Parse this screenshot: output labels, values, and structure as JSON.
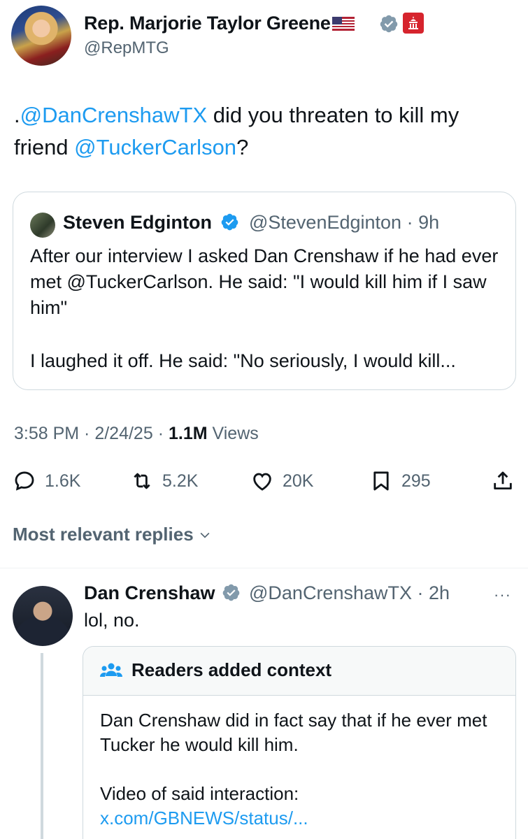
{
  "main_tweet": {
    "author_name": "Rep. Marjorie Taylor Greene",
    "author_handle": "@RepMTG",
    "text_prefix": ".",
    "mention_1": "@DanCrenshawTX",
    "text_middle": " did you threaten to kill my friend ",
    "mention_2": "@TuckerCarlson",
    "text_suffix": "?",
    "time": "3:58 PM",
    "sep_1": " · ",
    "date": "2/24/25",
    "sep_2": " · ",
    "views_count": "1.1M",
    "views_label": " Views"
  },
  "quoted_tweet": {
    "author_name": "Steven Edginton",
    "author_handle": "@StevenEdginton",
    "sep": " · ",
    "age": "9h",
    "text_paragraph_1": "After our interview I asked Dan Crenshaw if he had ever met @TuckerCarlson. He said: \"I would kill him if I saw him\"",
    "text_paragraph_2": "I laughed it off. He said: \"No seriously, I would kill..."
  },
  "actions": {
    "replies": "1.6K",
    "reposts": "5.2K",
    "likes": "20K",
    "bookmarks": "295"
  },
  "replies_sort": {
    "label": "Most relevant replies"
  },
  "reply": {
    "author_name": "Dan Crenshaw",
    "author_handle": "@DanCrenshawTX",
    "sep": " · ",
    "age": "2h",
    "more": "···",
    "text": "lol, no."
  },
  "community_note": {
    "title": "Readers added context",
    "text_paragraph_1": "Dan Crenshaw did in fact say that if he ever met Tucker he would kill him.",
    "text_paragraph_2": "Video of said interaction:",
    "link": "x.com/GBNEWS/status/..."
  },
  "colors": {
    "link_blue": "#1d9bf0",
    "secondary_text": "#536471",
    "border": "#cfd9de",
    "verified_gray": "#829aab",
    "verified_blue": "#1d9bf0"
  }
}
